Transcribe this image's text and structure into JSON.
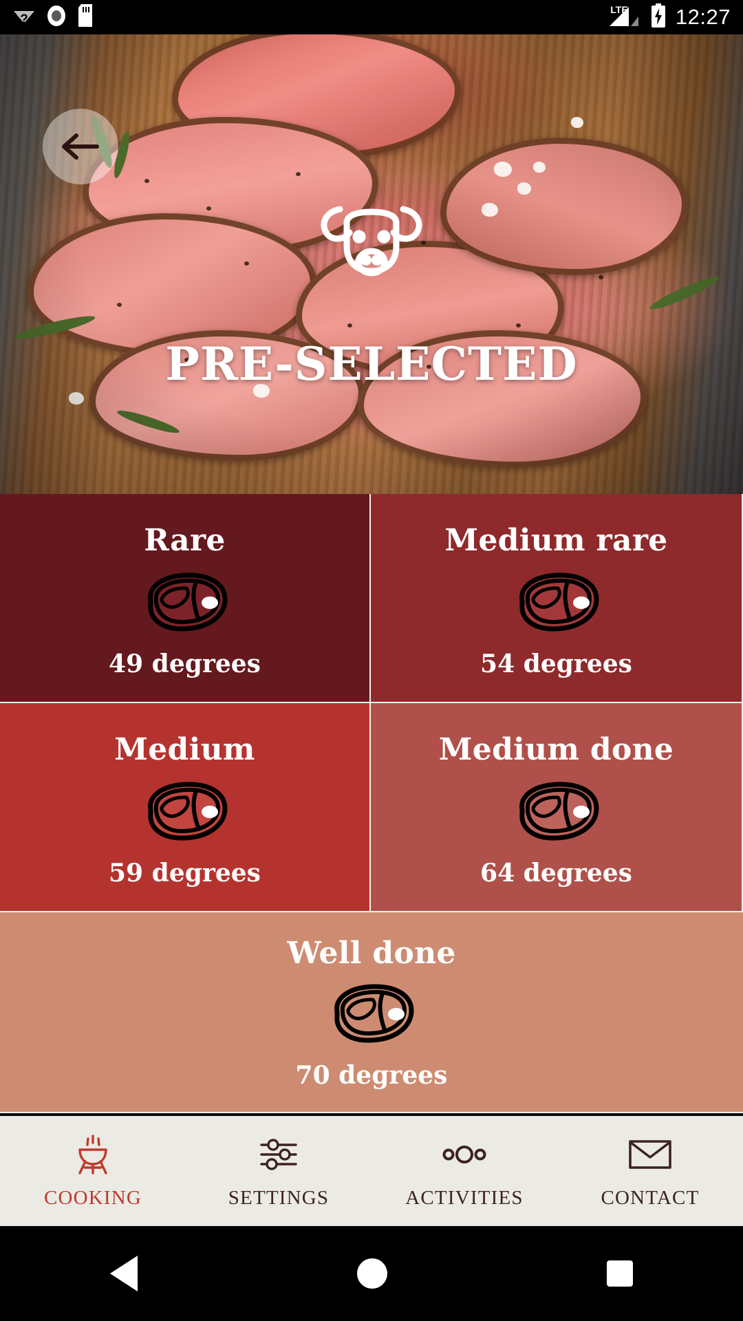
{
  "statusbar": {
    "time": "12:27",
    "network": "LTE",
    "icons": [
      "wifi-unknown-icon",
      "record-circle-icon",
      "sd-card-icon",
      "lte-label",
      "signal-bars-icon",
      "battery-charging-icon"
    ]
  },
  "hero": {
    "title": "PRE-SELECTED",
    "back_icon": "back-arrow-icon",
    "brand_icon": "bull-head-icon",
    "image_alt": "sliced-roast-beef-on-wooden-board"
  },
  "doneness": {
    "options": [
      {
        "label": "Rare",
        "temp": "49 degrees",
        "bg": "#63191e",
        "meat": "#7d2229",
        "icon": "steak-icon"
      },
      {
        "label": "Medium rare",
        "temp": "54 degrees",
        "bg": "#8e2a2c",
        "meat": "#a3383a",
        "icon": "steak-icon"
      },
      {
        "label": "Medium",
        "temp": "59 degrees",
        "bg": "#b5332f",
        "meat": "#c24540",
        "icon": "steak-icon"
      },
      {
        "label": "Medium done",
        "temp": "64 degrees",
        "bg": "#b0504a",
        "meat": "#bd635c",
        "icon": "steak-icon"
      },
      {
        "label": "Well done",
        "temp": "70 degrees",
        "bg": "#cd8c72",
        "meat": "#cd8c72",
        "icon": "steak-icon"
      }
    ]
  },
  "bottomnav": {
    "active_index": 0,
    "active_color": "#c0392b",
    "inactive_color": "#3b2320",
    "items": [
      {
        "label": "COOKING",
        "icon": "grill-icon"
      },
      {
        "label": "SETTINGS",
        "icon": "sliders-icon"
      },
      {
        "label": "ACTIVITIES",
        "icon": "three-circles-icon"
      },
      {
        "label": "CONTACT",
        "icon": "envelope-icon"
      }
    ]
  },
  "androidnav": {
    "items": [
      {
        "label": "Back",
        "icon": "triangle-back-icon"
      },
      {
        "label": "Home",
        "icon": "circle-home-icon"
      },
      {
        "label": "Recent",
        "icon": "square-recents-icon"
      }
    ]
  }
}
